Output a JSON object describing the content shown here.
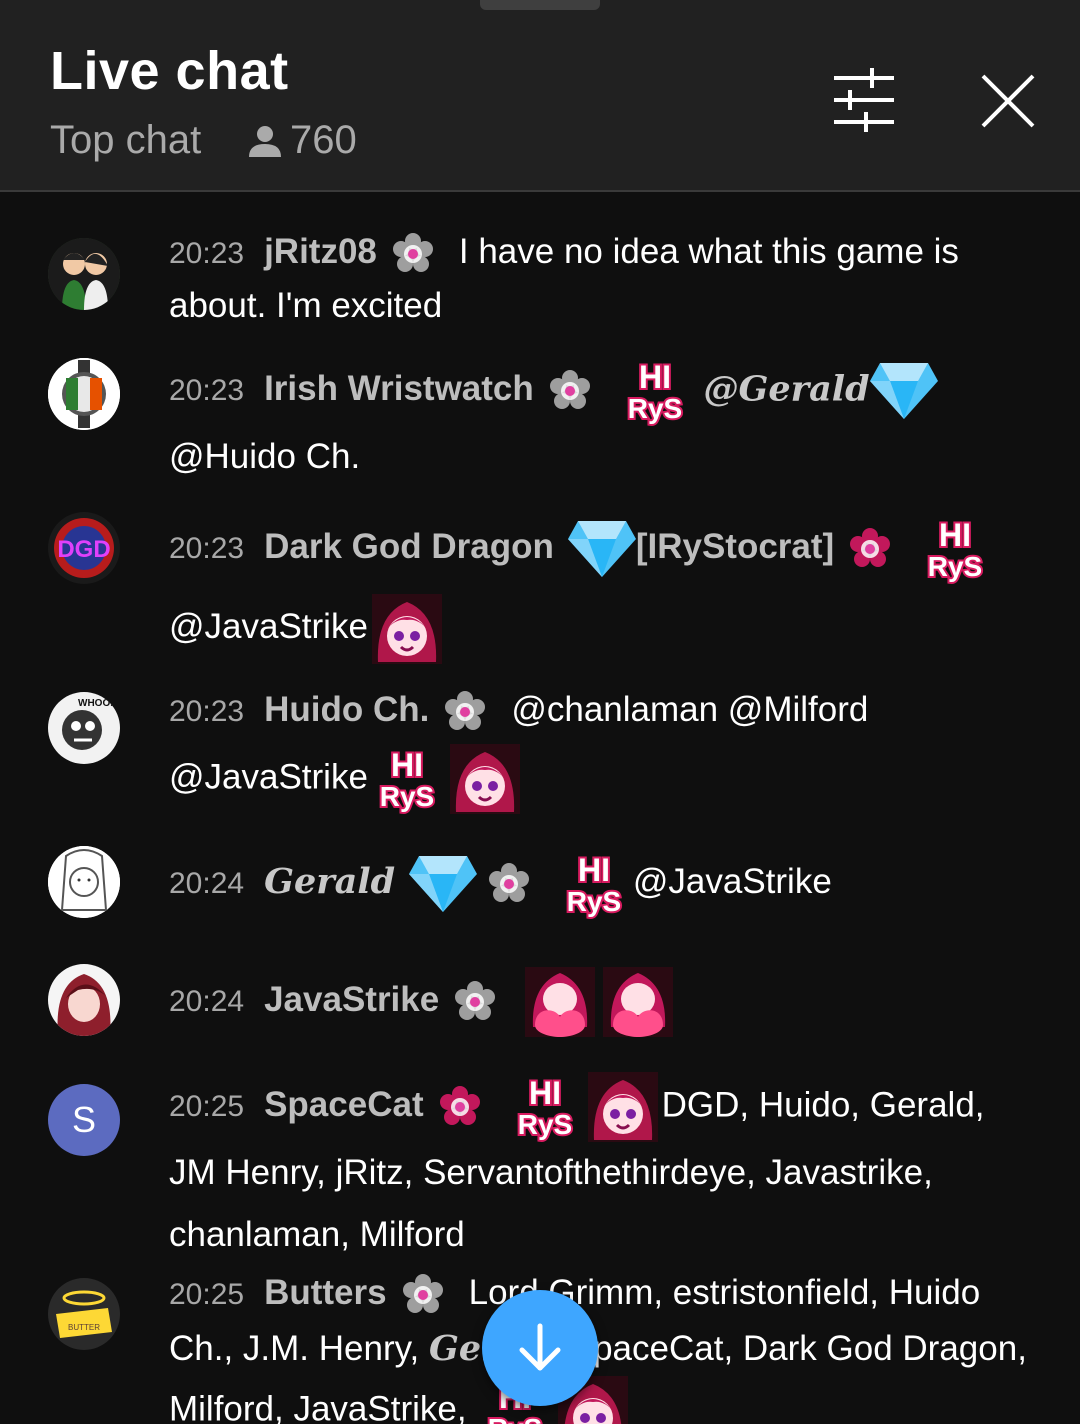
{
  "header": {
    "title": "Live chat",
    "mode": "Top chat",
    "viewer_count": "760"
  },
  "colors": {
    "accent": "#3ea6ff",
    "header_bg": "#212121",
    "feed_bg": "#0f0f0f",
    "member_badge": "#c2185b"
  },
  "messages": [
    {
      "time": "20:23",
      "author": "jRitz08",
      "text": "I have no idea what this game is about. I'm excited"
    },
    {
      "time": "20:23",
      "author": "Irish Wristwatch",
      "mention": "@Gerald",
      "text": "@Huido Ch."
    },
    {
      "time": "20:23",
      "author": "Dark God Dragon",
      "tag": "[IRyStocrat]",
      "text": "@JavaStrike"
    },
    {
      "time": "20:23",
      "author": "Huido Ch.",
      "text1": "@chanlaman @Milford",
      "text2": "@JavaStrike"
    },
    {
      "time": "20:24",
      "author": "Gerald",
      "text": "@JavaStrike"
    },
    {
      "time": "20:24",
      "author": "JavaStrike"
    },
    {
      "time": "20:25",
      "author": "SpaceCat",
      "avatar_letter": "S",
      "text1": "DGD, Huido, Gerald,",
      "text2": "JM Henry, jRitz, Servantofthethirdeye, Javastrike, chanlaman, Milford"
    },
    {
      "time": "20:25",
      "author": "Butters",
      "text1": "Lord Grimm, estristonfield, Huido",
      "text2": "Ch., J.M. Henry,",
      "gerald": "Gerald",
      "text3": "SpaceCat, Dark God Dragon,",
      "text4": "Milford, JavaStrike,"
    }
  ],
  "icons": [
    "person-icon",
    "tune-icon",
    "close-icon",
    "arrow-down-icon",
    "member-badge-icon",
    "diamond-emoji",
    "hi-rys-emoji",
    "irys-emoji"
  ]
}
